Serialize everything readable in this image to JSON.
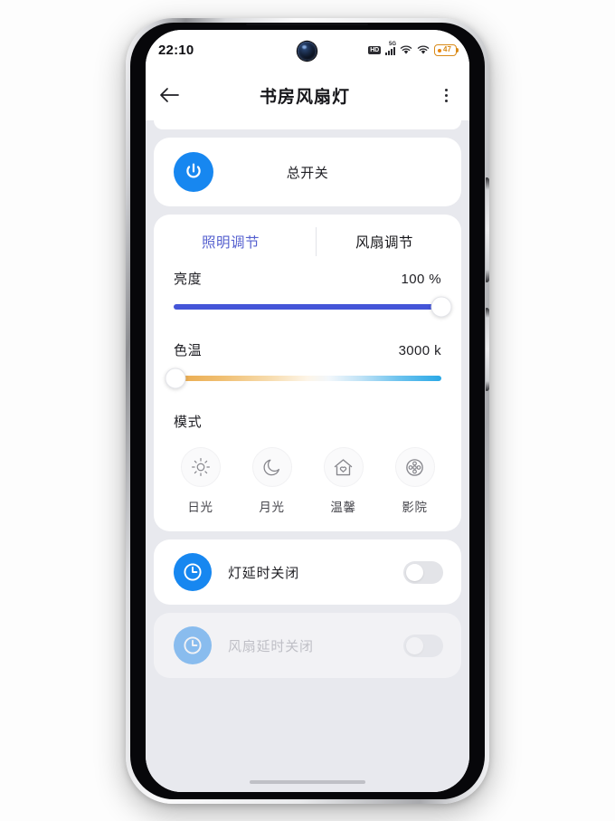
{
  "status_bar": {
    "time": "22:10",
    "hd_label": "HD",
    "network_label": "5G",
    "battery_level": "47",
    "icons": [
      "hd-icon",
      "signal-icon",
      "wifi-icon",
      "wifi-icon",
      "battery-icon"
    ]
  },
  "app_bar": {
    "back_icon": "arrow-left-icon",
    "title": "书房风扇灯",
    "menu_icon": "more-vertical-icon"
  },
  "power": {
    "icon": "power-icon",
    "label": "总开关"
  },
  "tabs": [
    {
      "label": "照明调节",
      "active": true
    },
    {
      "label": "风扇调节",
      "active": false
    }
  ],
  "brightness": {
    "label": "亮度",
    "value_text": "100 %",
    "value": 100,
    "min": 0,
    "max": 100,
    "fill_color": "#4455d8"
  },
  "color_temp": {
    "label": "色温",
    "value_text": "3000 k",
    "value": 3000,
    "min": 3000,
    "max": 6500,
    "gradient_from": "#e9a94b",
    "gradient_to": "#2aa8e6"
  },
  "mode": {
    "title": "模式",
    "items": [
      {
        "label": "日光",
        "icon": "sun-icon"
      },
      {
        "label": "月光",
        "icon": "moon-icon"
      },
      {
        "label": "温馨",
        "icon": "home-heart-icon"
      },
      {
        "label": "影院",
        "icon": "film-reel-icon"
      }
    ]
  },
  "delays": [
    {
      "label": "灯延时关闭",
      "icon": "clock-icon",
      "enabled": true,
      "toggle_on": false
    },
    {
      "label": "风扇延时关闭",
      "icon": "clock-icon",
      "enabled": false,
      "toggle_on": false
    }
  ],
  "theme": {
    "accent_blue": "#1787f0",
    "tab_active": "#5560cf",
    "page_bg": "#e8e9ee",
    "card_bg": "#ffffff"
  }
}
